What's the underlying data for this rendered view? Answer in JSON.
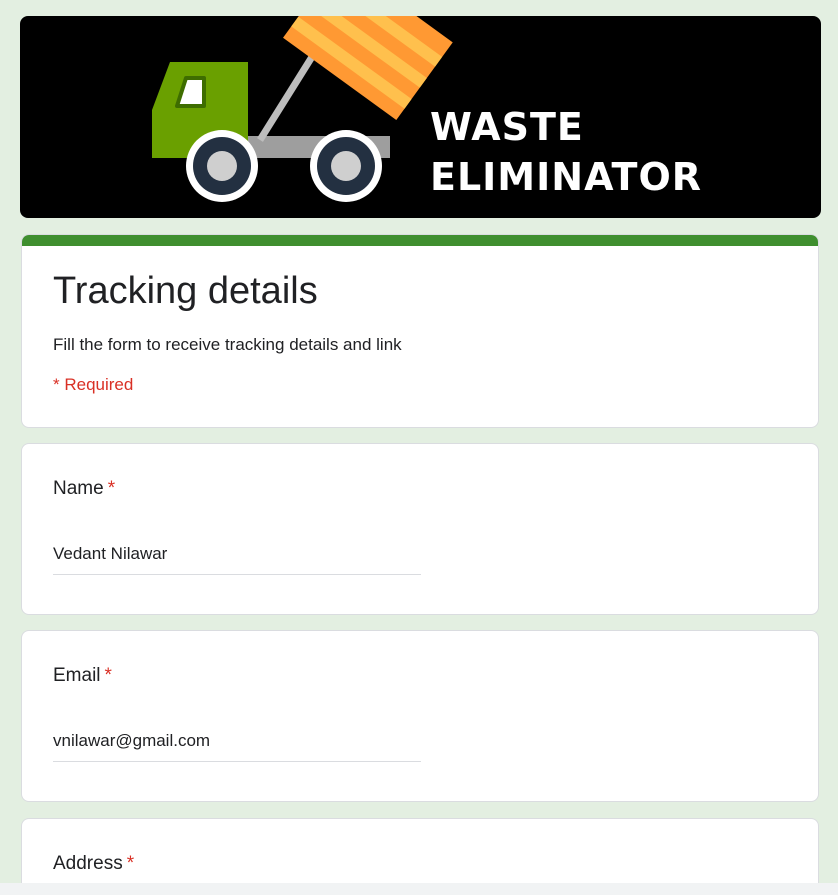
{
  "banner": {
    "line1": "WASTE",
    "line2": "ELIMINATOR",
    "logo_icon": "dump-truck-icon",
    "colors": {
      "background": "#000000",
      "truck_cab": "#6aa000",
      "dump_bin": "#ff9933",
      "dump_bin_stripes": "#ffc04d",
      "wheel": "#233041"
    }
  },
  "form": {
    "title": "Tracking details",
    "description": "Fill the form to receive tracking details and link",
    "required_note": "* Required",
    "accent_color": "#3f8f2f"
  },
  "questions": {
    "name": {
      "label": "Name",
      "required_mark": "*",
      "value": "Vedant Nilawar"
    },
    "email": {
      "label": "Email",
      "required_mark": "*",
      "value": "vnilawar@gmail.com"
    },
    "address": {
      "label": "Address",
      "required_mark": "*"
    }
  }
}
